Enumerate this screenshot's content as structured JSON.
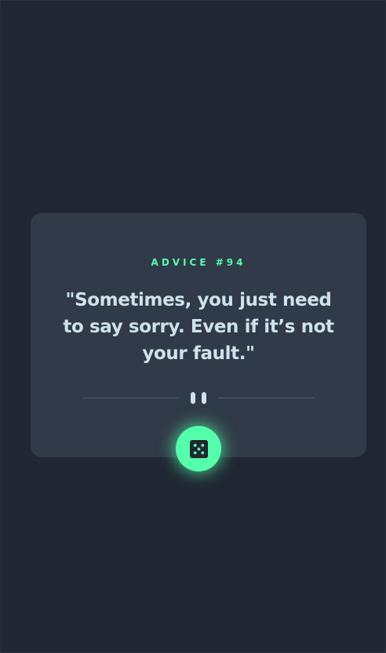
{
  "advice": {
    "id_label": "ADVICE #94",
    "quote": "\"Sometimes, you just need to say sorry. Even if it’s not your fault.\""
  },
  "icons": {
    "divider": "pause-icon",
    "button": "dice-icon"
  },
  "colors": {
    "background": "#202632",
    "card": "#313a48",
    "accent": "#53ffaa",
    "text": "#cee3e9",
    "divider": "#4f5d74"
  }
}
